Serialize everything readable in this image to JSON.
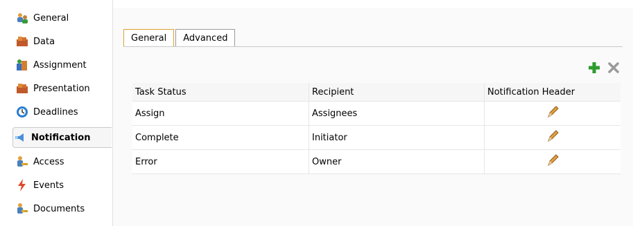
{
  "sidebar": {
    "items": [
      {
        "label": "General",
        "icon": "users-icon"
      },
      {
        "label": "Data",
        "icon": "data-icon"
      },
      {
        "label": "Assignment",
        "icon": "assignment-icon"
      },
      {
        "label": "Presentation",
        "icon": "presentation-icon"
      },
      {
        "label": "Deadlines",
        "icon": "deadlines-icon"
      },
      {
        "label": "Notification",
        "icon": "notification-icon",
        "active": true
      },
      {
        "label": "Access",
        "icon": "access-icon"
      },
      {
        "label": "Events",
        "icon": "events-icon"
      },
      {
        "label": "Documents",
        "icon": "documents-icon"
      }
    ]
  },
  "tabs": [
    {
      "label": "General",
      "active": true
    },
    {
      "label": "Advanced",
      "active": false
    }
  ],
  "toolbar": {
    "add_icon": "add-icon",
    "delete_icon": "delete-icon"
  },
  "table": {
    "columns": [
      "Task Status",
      "Recipient",
      "Notification Header"
    ],
    "rows": [
      {
        "task_status": "Assign",
        "recipient": "Assignees",
        "header_icon": "pencil-icon"
      },
      {
        "task_status": "Complete",
        "recipient": "Initiator",
        "header_icon": "pencil-icon"
      },
      {
        "task_status": "Error",
        "recipient": "Owner",
        "header_icon": "pencil-icon"
      }
    ]
  },
  "colors": {
    "active_tab_border": "#e0a030",
    "add_icon": "#2e9b2e",
    "delete_icon": "#9a9a9a",
    "pencil": "#c07a1a"
  }
}
